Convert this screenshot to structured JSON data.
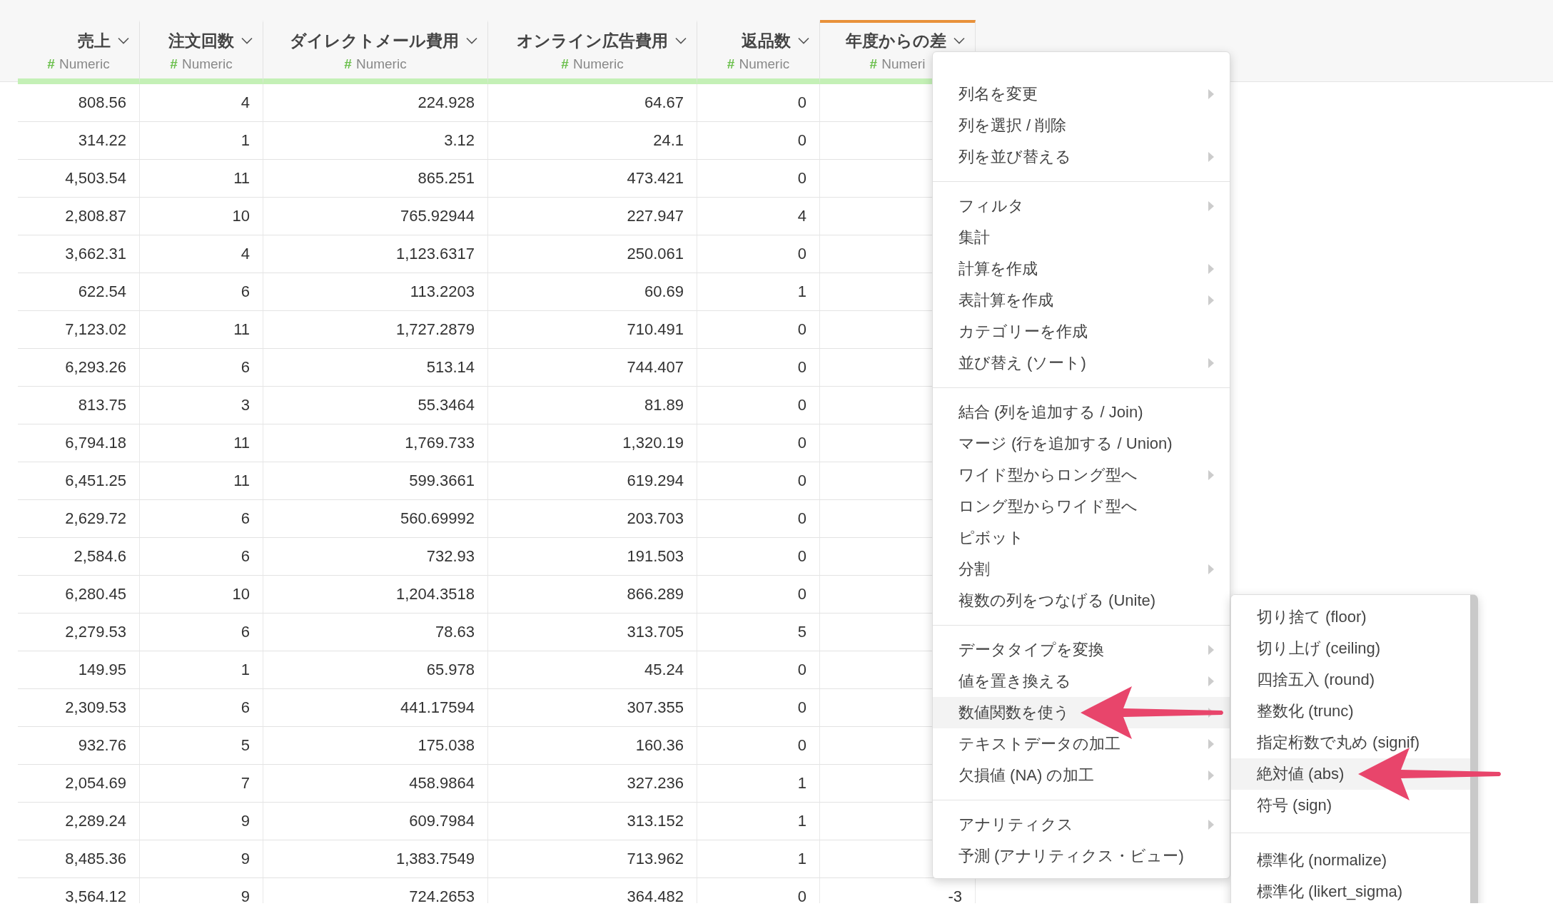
{
  "table": {
    "columns": [
      {
        "name": "売上",
        "type_icon": "#",
        "type": "Numeric",
        "selected": false
      },
      {
        "name": "注文回数",
        "type_icon": "#",
        "type": "Numeric",
        "selected": false
      },
      {
        "name": "ダイレクトメール費用",
        "type_icon": "#",
        "type": "Numeric",
        "selected": false
      },
      {
        "name": "オンライン広告費用",
        "type_icon": "#",
        "type": "Numeric",
        "selected": false
      },
      {
        "name": "返品数",
        "type_icon": "#",
        "type": "Numeric",
        "selected": false
      },
      {
        "name": "年度からの差",
        "type_icon": "#",
        "type": "Numeri",
        "selected": true
      }
    ],
    "rows": [
      [
        "808.56",
        "4",
        "224.928",
        "64.67",
        "0"
      ],
      [
        "314.22",
        "1",
        "3.12",
        "24.1",
        "0"
      ],
      [
        "4,503.54",
        "11",
        "865.251",
        "473.421",
        "0"
      ],
      [
        "2,808.87",
        "10",
        "765.92944",
        "227.947",
        "4"
      ],
      [
        "3,662.31",
        "4",
        "1,123.6317",
        "250.061",
        "0"
      ],
      [
        "622.54",
        "6",
        "113.2203",
        "60.69",
        "1"
      ],
      [
        "7,123.02",
        "11",
        "1,727.2879",
        "710.491",
        "0"
      ],
      [
        "6,293.26",
        "6",
        "513.14",
        "744.407",
        "0"
      ],
      [
        "813.75",
        "3",
        "55.3464",
        "81.89",
        "0"
      ],
      [
        "6,794.18",
        "11",
        "1,769.733",
        "1,320.19",
        "0"
      ],
      [
        "6,451.25",
        "11",
        "599.3661",
        "619.294",
        "0"
      ],
      [
        "2,629.72",
        "6",
        "560.69992",
        "203.703",
        "0"
      ],
      [
        "2,584.6",
        "6",
        "732.93",
        "191.503",
        "0"
      ],
      [
        "6,280.45",
        "10",
        "1,204.3518",
        "866.289",
        "0"
      ],
      [
        "2,279.53",
        "6",
        "78.63",
        "313.705",
        "5"
      ],
      [
        "149.95",
        "1",
        "65.978",
        "45.24",
        "0"
      ],
      [
        "2,309.53",
        "6",
        "441.17594",
        "307.355",
        "0"
      ],
      [
        "932.76",
        "5",
        "175.038",
        "160.36",
        "0"
      ],
      [
        "2,054.69",
        "7",
        "458.9864",
        "327.236",
        "1"
      ],
      [
        "2,289.24",
        "9",
        "609.7984",
        "313.152",
        "1"
      ],
      [
        "8,485.36",
        "9",
        "1,383.7549",
        "713.962",
        "1"
      ],
      [
        "3,564.12",
        "9",
        "724.2653",
        "364.482",
        "0",
        "-3"
      ]
    ]
  },
  "context_menu": {
    "groups": [
      [
        {
          "label": "列名を変更",
          "has_submenu": true,
          "highlighted": false,
          "annotation_arrow": false
        },
        {
          "label": "列を選択 / 削除",
          "has_submenu": false,
          "highlighted": false,
          "annotation_arrow": false
        },
        {
          "label": "列を並び替える",
          "has_submenu": true,
          "highlighted": false,
          "annotation_arrow": false
        }
      ],
      [
        {
          "label": "フィルタ",
          "has_submenu": true,
          "highlighted": false,
          "annotation_arrow": false
        },
        {
          "label": "集計",
          "has_submenu": false,
          "highlighted": false,
          "annotation_arrow": false
        },
        {
          "label": "計算を作成",
          "has_submenu": true,
          "highlighted": false,
          "annotation_arrow": false
        },
        {
          "label": "表計算を作成",
          "has_submenu": true,
          "highlighted": false,
          "annotation_arrow": false
        },
        {
          "label": "カテゴリーを作成",
          "has_submenu": false,
          "highlighted": false,
          "annotation_arrow": false
        },
        {
          "label": "並び替え (ソート)",
          "has_submenu": true,
          "highlighted": false,
          "annotation_arrow": false
        }
      ],
      [
        {
          "label": "結合 (列を追加する / Join)",
          "has_submenu": false,
          "highlighted": false,
          "annotation_arrow": false
        },
        {
          "label": "マージ (行を追加する / Union)",
          "has_submenu": false,
          "highlighted": false,
          "annotation_arrow": false
        },
        {
          "label": "ワイド型からロング型へ",
          "has_submenu": true,
          "highlighted": false,
          "annotation_arrow": false
        },
        {
          "label": "ロング型からワイド型へ",
          "has_submenu": false,
          "highlighted": false,
          "annotation_arrow": false
        },
        {
          "label": "ピボット",
          "has_submenu": false,
          "highlighted": false,
          "annotation_arrow": false
        },
        {
          "label": "分割",
          "has_submenu": true,
          "highlighted": false,
          "annotation_arrow": false
        },
        {
          "label": "複数の列をつなげる (Unite)",
          "has_submenu": false,
          "highlighted": false,
          "annotation_arrow": false
        }
      ],
      [
        {
          "label": "データタイプを変換",
          "has_submenu": true,
          "highlighted": false,
          "annotation_arrow": false
        },
        {
          "label": "値を置き換える",
          "has_submenu": true,
          "highlighted": false,
          "annotation_arrow": false
        },
        {
          "label": "数値関数を使う",
          "has_submenu": true,
          "highlighted": true,
          "annotation_arrow": true
        },
        {
          "label": "テキストデータの加工",
          "has_submenu": true,
          "highlighted": false,
          "annotation_arrow": false
        },
        {
          "label": "欠損値 (NA) の加工",
          "has_submenu": true,
          "highlighted": false,
          "annotation_arrow": false
        }
      ],
      [
        {
          "label": "アナリティクス",
          "has_submenu": true,
          "highlighted": false,
          "annotation_arrow": false
        },
        {
          "label": "予測 (アナリティクス・ビュー)",
          "has_submenu": false,
          "highlighted": false,
          "annotation_arrow": false
        }
      ]
    ]
  },
  "submenu": {
    "groups": [
      [
        {
          "label": "切り捨て (floor)",
          "highlighted": false,
          "annotation_arrow": false
        },
        {
          "label": "切り上げ (ceiling)",
          "highlighted": false,
          "annotation_arrow": false
        },
        {
          "label": "四捨五入 (round)",
          "highlighted": false,
          "annotation_arrow": false
        },
        {
          "label": "整数化 (trunc)",
          "highlighted": false,
          "annotation_arrow": false
        },
        {
          "label": "指定桁数で丸め (signif)",
          "highlighted": false,
          "annotation_arrow": false
        },
        {
          "label": "絶対値 (abs)",
          "highlighted": true,
          "annotation_arrow": true
        },
        {
          "label": "符号 (sign)",
          "highlighted": false,
          "annotation_arrow": false
        }
      ],
      [
        {
          "label": "標準化 (normalize)",
          "highlighted": false,
          "annotation_arrow": false
        },
        {
          "label": "標準化 (likert_sigma)",
          "highlighted": false,
          "annotation_arrow": false
        }
      ]
    ]
  }
}
